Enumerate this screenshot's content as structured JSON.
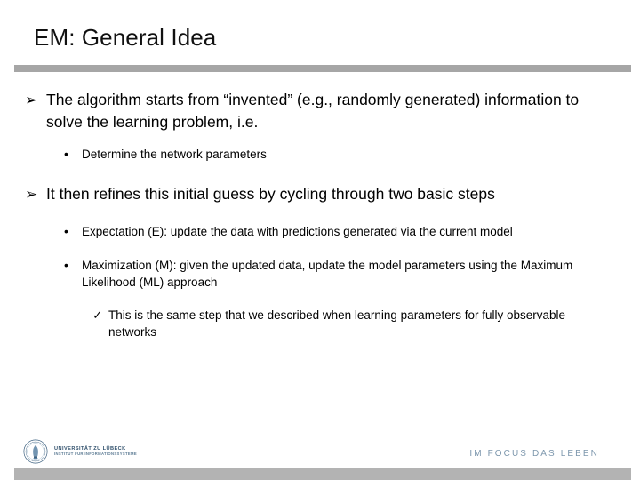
{
  "slide": {
    "title": "EM: General Idea",
    "accent_rule_color": "#a6a6a6",
    "footer_bar_color": "#b3b3b3",
    "text_color": "#000000"
  },
  "content": {
    "bullets": [
      {
        "level": 1,
        "marker": "➢",
        "text": "The algorithm starts from “invented” (e.g., randomly generated) information  to solve the learning problem, i.e."
      },
      {
        "level": 2,
        "marker": "•",
        "text": "Determine the network parameters"
      },
      {
        "level": 1,
        "marker": "➢",
        "text": "It then refines this initial guess by cycling through two basic steps"
      },
      {
        "level": 2,
        "marker": "•",
        "text": "Expectation (E): update the data with predictions generated via the current model"
      },
      {
        "level": 2,
        "marker": "•",
        "text": "Maximization (M): given the updated data, update the model parameters using the Maximum Likelihood (ML) approach"
      },
      {
        "level": 3,
        "marker": "✓",
        "text": "This is the same step that we described when learning parameters for fully observable networks"
      }
    ]
  },
  "footer": {
    "logo_name": "UNIVERSITÄT ZU LÜBECK",
    "logo_subtitle": "INSTITUT FÜR INFORMATIONSSYSTEME",
    "tagline": "IM FOCUS DAS LEBEN",
    "logo_color": "#2f4f6b",
    "tagline_color": "#7d97ad"
  }
}
